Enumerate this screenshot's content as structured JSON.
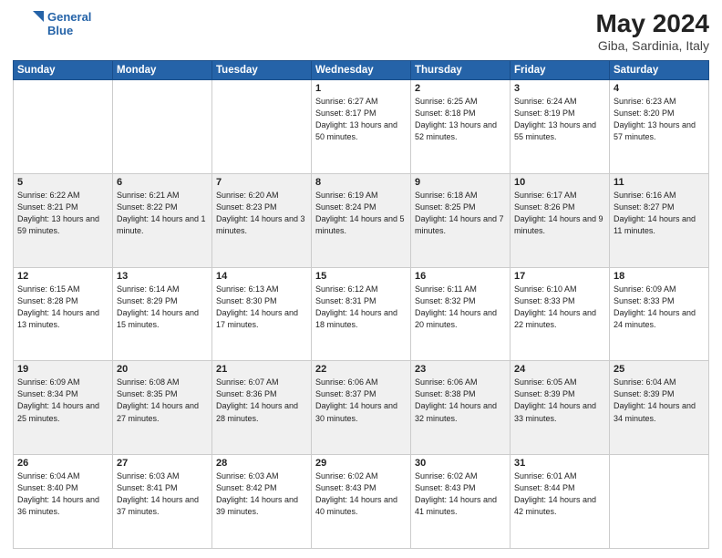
{
  "header": {
    "logo_line1": "General",
    "logo_line2": "Blue",
    "title": "May 2024",
    "location": "Giba, Sardinia, Italy"
  },
  "weekdays": [
    "Sunday",
    "Monday",
    "Tuesday",
    "Wednesday",
    "Thursday",
    "Friday",
    "Saturday"
  ],
  "weeks": [
    [
      {
        "day": "",
        "info": ""
      },
      {
        "day": "",
        "info": ""
      },
      {
        "day": "",
        "info": ""
      },
      {
        "day": "1",
        "info": "Sunrise: 6:27 AM\nSunset: 8:17 PM\nDaylight: 13 hours\nand 50 minutes."
      },
      {
        "day": "2",
        "info": "Sunrise: 6:25 AM\nSunset: 8:18 PM\nDaylight: 13 hours\nand 52 minutes."
      },
      {
        "day": "3",
        "info": "Sunrise: 6:24 AM\nSunset: 8:19 PM\nDaylight: 13 hours\nand 55 minutes."
      },
      {
        "day": "4",
        "info": "Sunrise: 6:23 AM\nSunset: 8:20 PM\nDaylight: 13 hours\nand 57 minutes."
      }
    ],
    [
      {
        "day": "5",
        "info": "Sunrise: 6:22 AM\nSunset: 8:21 PM\nDaylight: 13 hours\nand 59 minutes."
      },
      {
        "day": "6",
        "info": "Sunrise: 6:21 AM\nSunset: 8:22 PM\nDaylight: 14 hours\nand 1 minute."
      },
      {
        "day": "7",
        "info": "Sunrise: 6:20 AM\nSunset: 8:23 PM\nDaylight: 14 hours\nand 3 minutes."
      },
      {
        "day": "8",
        "info": "Sunrise: 6:19 AM\nSunset: 8:24 PM\nDaylight: 14 hours\nand 5 minutes."
      },
      {
        "day": "9",
        "info": "Sunrise: 6:18 AM\nSunset: 8:25 PM\nDaylight: 14 hours\nand 7 minutes."
      },
      {
        "day": "10",
        "info": "Sunrise: 6:17 AM\nSunset: 8:26 PM\nDaylight: 14 hours\nand 9 minutes."
      },
      {
        "day": "11",
        "info": "Sunrise: 6:16 AM\nSunset: 8:27 PM\nDaylight: 14 hours\nand 11 minutes."
      }
    ],
    [
      {
        "day": "12",
        "info": "Sunrise: 6:15 AM\nSunset: 8:28 PM\nDaylight: 14 hours\nand 13 minutes."
      },
      {
        "day": "13",
        "info": "Sunrise: 6:14 AM\nSunset: 8:29 PM\nDaylight: 14 hours\nand 15 minutes."
      },
      {
        "day": "14",
        "info": "Sunrise: 6:13 AM\nSunset: 8:30 PM\nDaylight: 14 hours\nand 17 minutes."
      },
      {
        "day": "15",
        "info": "Sunrise: 6:12 AM\nSunset: 8:31 PM\nDaylight: 14 hours\nand 18 minutes."
      },
      {
        "day": "16",
        "info": "Sunrise: 6:11 AM\nSunset: 8:32 PM\nDaylight: 14 hours\nand 20 minutes."
      },
      {
        "day": "17",
        "info": "Sunrise: 6:10 AM\nSunset: 8:33 PM\nDaylight: 14 hours\nand 22 minutes."
      },
      {
        "day": "18",
        "info": "Sunrise: 6:09 AM\nSunset: 8:33 PM\nDaylight: 14 hours\nand 24 minutes."
      }
    ],
    [
      {
        "day": "19",
        "info": "Sunrise: 6:09 AM\nSunset: 8:34 PM\nDaylight: 14 hours\nand 25 minutes."
      },
      {
        "day": "20",
        "info": "Sunrise: 6:08 AM\nSunset: 8:35 PM\nDaylight: 14 hours\nand 27 minutes."
      },
      {
        "day": "21",
        "info": "Sunrise: 6:07 AM\nSunset: 8:36 PM\nDaylight: 14 hours\nand 28 minutes."
      },
      {
        "day": "22",
        "info": "Sunrise: 6:06 AM\nSunset: 8:37 PM\nDaylight: 14 hours\nand 30 minutes."
      },
      {
        "day": "23",
        "info": "Sunrise: 6:06 AM\nSunset: 8:38 PM\nDaylight: 14 hours\nand 32 minutes."
      },
      {
        "day": "24",
        "info": "Sunrise: 6:05 AM\nSunset: 8:39 PM\nDaylight: 14 hours\nand 33 minutes."
      },
      {
        "day": "25",
        "info": "Sunrise: 6:04 AM\nSunset: 8:39 PM\nDaylight: 14 hours\nand 34 minutes."
      }
    ],
    [
      {
        "day": "26",
        "info": "Sunrise: 6:04 AM\nSunset: 8:40 PM\nDaylight: 14 hours\nand 36 minutes."
      },
      {
        "day": "27",
        "info": "Sunrise: 6:03 AM\nSunset: 8:41 PM\nDaylight: 14 hours\nand 37 minutes."
      },
      {
        "day": "28",
        "info": "Sunrise: 6:03 AM\nSunset: 8:42 PM\nDaylight: 14 hours\nand 39 minutes."
      },
      {
        "day": "29",
        "info": "Sunrise: 6:02 AM\nSunset: 8:43 PM\nDaylight: 14 hours\nand 40 minutes."
      },
      {
        "day": "30",
        "info": "Sunrise: 6:02 AM\nSunset: 8:43 PM\nDaylight: 14 hours\nand 41 minutes."
      },
      {
        "day": "31",
        "info": "Sunrise: 6:01 AM\nSunset: 8:44 PM\nDaylight: 14 hours\nand 42 minutes."
      },
      {
        "day": "",
        "info": ""
      }
    ]
  ]
}
